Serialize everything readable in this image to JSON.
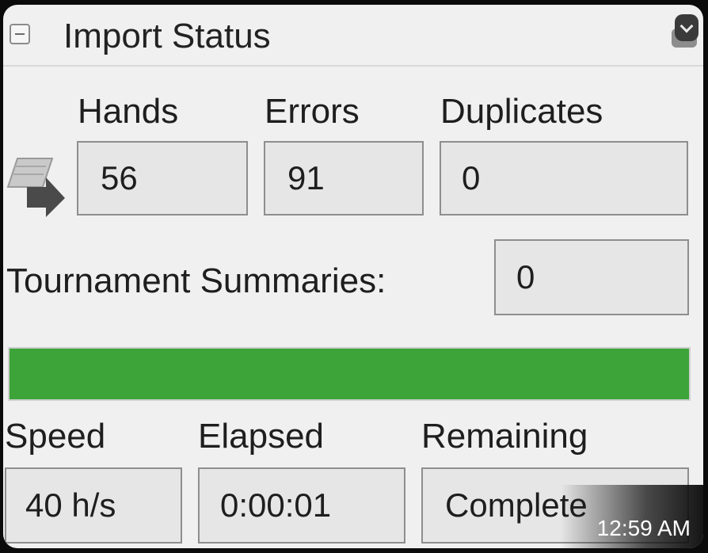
{
  "window": {
    "title": "Import Status"
  },
  "counts": {
    "hands_label": "Hands",
    "errors_label": "Errors",
    "duplicates_label": "Duplicates",
    "hands_value": "56",
    "errors_value": "91",
    "duplicates_value": "0"
  },
  "tournaments": {
    "label": "Tournament Summaries:",
    "value": "0"
  },
  "progress": {
    "fraction": 1.0,
    "color": "#3da43a"
  },
  "timing": {
    "speed_label": "Speed",
    "elapsed_label": "Elapsed",
    "remaining_label": "Remaining",
    "speed_value": "40 h/s",
    "elapsed_value": "0:00:01",
    "remaining_value": "Complete"
  },
  "system": {
    "clock": "12:59 AM"
  },
  "icons": {
    "collapse": "collapse-icon",
    "import": "import-arrow-icon",
    "menu": "chevron-down-icon"
  }
}
